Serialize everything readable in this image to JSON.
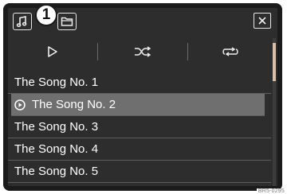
{
  "header": {
    "tabs": [
      {
        "icon": "music-note-icon"
      },
      {
        "icon": "folder-icon"
      }
    ],
    "callout_number": "1",
    "close_icon": "close-icon"
  },
  "controls": [
    {
      "icon": "play-icon"
    },
    {
      "icon": "shuffle-icon"
    },
    {
      "icon": "repeat-icon"
    }
  ],
  "songs": [
    {
      "title": "The Song No. 1",
      "playing": false
    },
    {
      "title": "The Song No. 2",
      "playing": true
    },
    {
      "title": "The Song No. 3",
      "playing": false
    },
    {
      "title": "The Song No. 4",
      "playing": false
    },
    {
      "title": "The Song No. 5",
      "playing": false
    }
  ],
  "scroll": {
    "position_fraction": 0.0
  },
  "figure_code": "BR5-0295",
  "colors": {
    "frame": "#1b1b1b",
    "screen": "#2d2d2d",
    "active_row": "#6f6f6f",
    "scroll_thumb": "#d8c0a6",
    "text": "#ffffff"
  }
}
